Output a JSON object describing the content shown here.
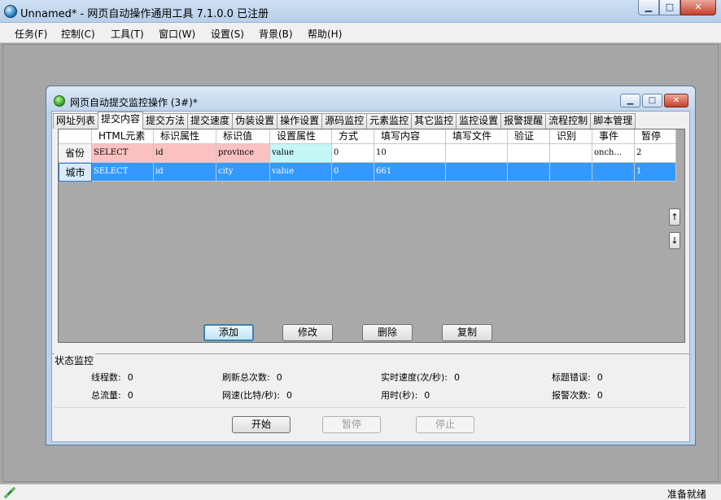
{
  "window": {
    "title": "Unnamed* - 网页自动操作通用工具 7.1.0.0  已注册",
    "min_glyph": "▁",
    "max_glyph": "□",
    "close_glyph": "✕"
  },
  "menu": [
    "任务(F)",
    "控制(C)",
    "工具(T)",
    "窗口(W)",
    "设置(S)",
    "背景(B)",
    "帮助(H)"
  ],
  "child": {
    "title": "网页自动提交监控操作  (3#)*",
    "tabs": [
      "网址列表",
      "提交内容",
      "提交方法",
      "提交速度",
      "伪装设置",
      "操作设置",
      "源码监控",
      "元素监控",
      "其它监控",
      "监控设置",
      "报警提醒",
      "流程控制",
      "脚本管理"
    ],
    "active_tab": "提交内容"
  },
  "grid": {
    "headers": [
      "",
      "HTML元素",
      "标识属性",
      "标识值",
      "设置属性",
      "方式",
      "填写内容",
      "填写文件",
      "验证",
      "识别",
      "事件",
      "暂停"
    ],
    "rows": [
      {
        "label": "省份",
        "cells": [
          "SELECT",
          "id",
          "province",
          "value",
          "0",
          "10",
          "",
          "",
          "",
          "onch...",
          "2"
        ]
      },
      {
        "label": "城市",
        "cells": [
          "SELECT",
          "id",
          "city",
          "value",
          "0",
          "661",
          "",
          "",
          "",
          "",
          "1"
        ]
      }
    ],
    "selected_row": "城市",
    "up_glyph": "↑",
    "down_glyph": "↓"
  },
  "buttons": {
    "add": "添加",
    "edit": "修改",
    "delete": "删除",
    "copy": "复制"
  },
  "monitor": {
    "title": "状态监控",
    "stats": {
      "threads": {
        "label": "线程数:",
        "value": "0"
      },
      "refresh_total": {
        "label": "刷新总次数:",
        "value": "0"
      },
      "realtime_speed": {
        "label": "实时速度(次/秒):",
        "value": "0"
      },
      "title_errors": {
        "label": "标题错误:",
        "value": "0"
      },
      "total_traffic": {
        "label": "总流量:",
        "value": "0"
      },
      "net_speed": {
        "label": "网速(比特/秒):",
        "value": "0"
      },
      "elapsed": {
        "label": "用时(秒):",
        "value": "0"
      },
      "alarm_count": {
        "label": "报警次数:",
        "value": "0"
      }
    },
    "start": "开始",
    "pause": "暂停",
    "stop": "停止"
  },
  "status": {
    "text": "准备就绪"
  },
  "colors": {
    "selected_row": "#3399ff",
    "pink_cell": "#fbc1c1",
    "cyan_cell": "#c6f7f7",
    "workspace": "#a6a6a6"
  }
}
